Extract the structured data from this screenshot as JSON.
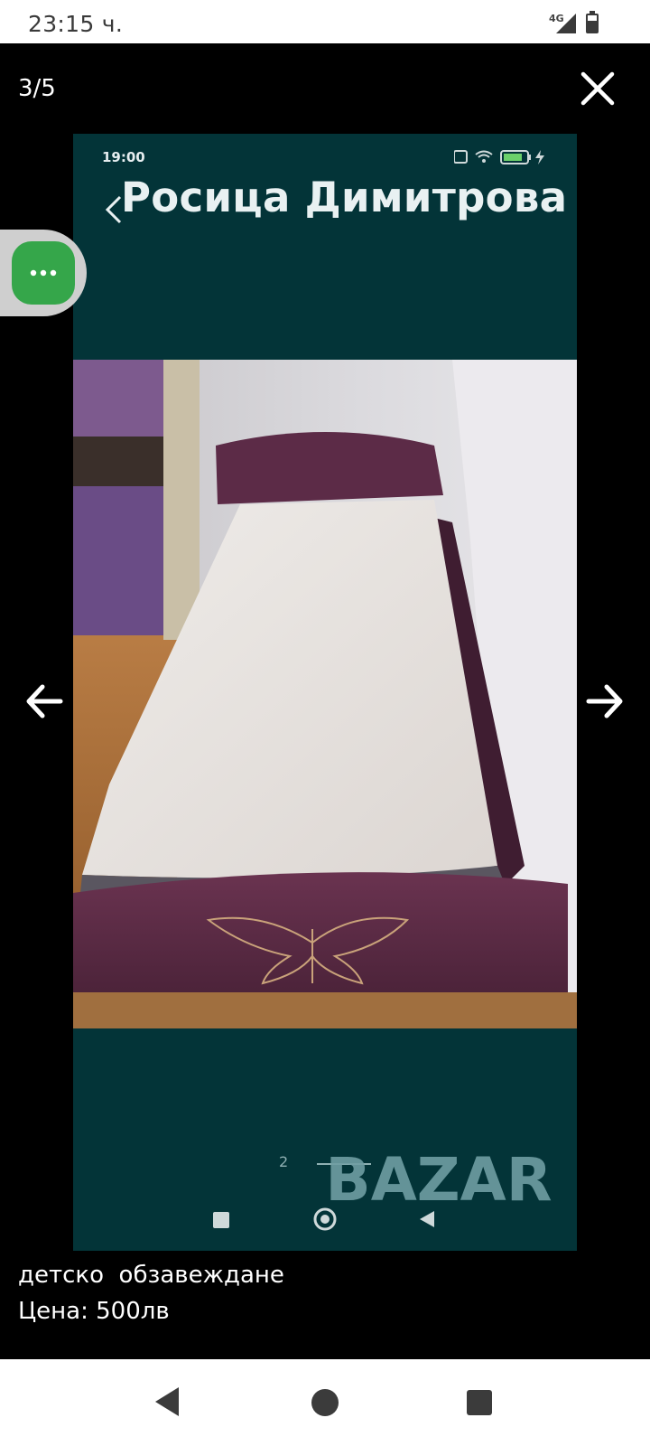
{
  "status_bar": {
    "time": "23:15 ч.",
    "network": "4G",
    "icons": [
      "signal-icon",
      "battery-icon"
    ]
  },
  "viewer": {
    "counter": "3/5",
    "close_icon": "close-icon",
    "prev_icon": "arrow-left-icon",
    "next_icon": "arrow-right-icon",
    "chat_icon": "more-dots-icon"
  },
  "photo": {
    "inner_time": "19:00",
    "inner_contact_name": "Росица Димитрова",
    "inner_pager_label": "2",
    "watermark": "BAZAR"
  },
  "caption": {
    "title": "детско  обзавеждане",
    "price": "Цена: 500лв"
  },
  "colors": {
    "photo_background": "#033438",
    "chat_button": "#35a64a",
    "bed_frame": "#5a2b45"
  },
  "system_nav": {
    "icons": [
      "back-triangle-icon",
      "home-circle-icon",
      "recents-square-icon"
    ]
  }
}
